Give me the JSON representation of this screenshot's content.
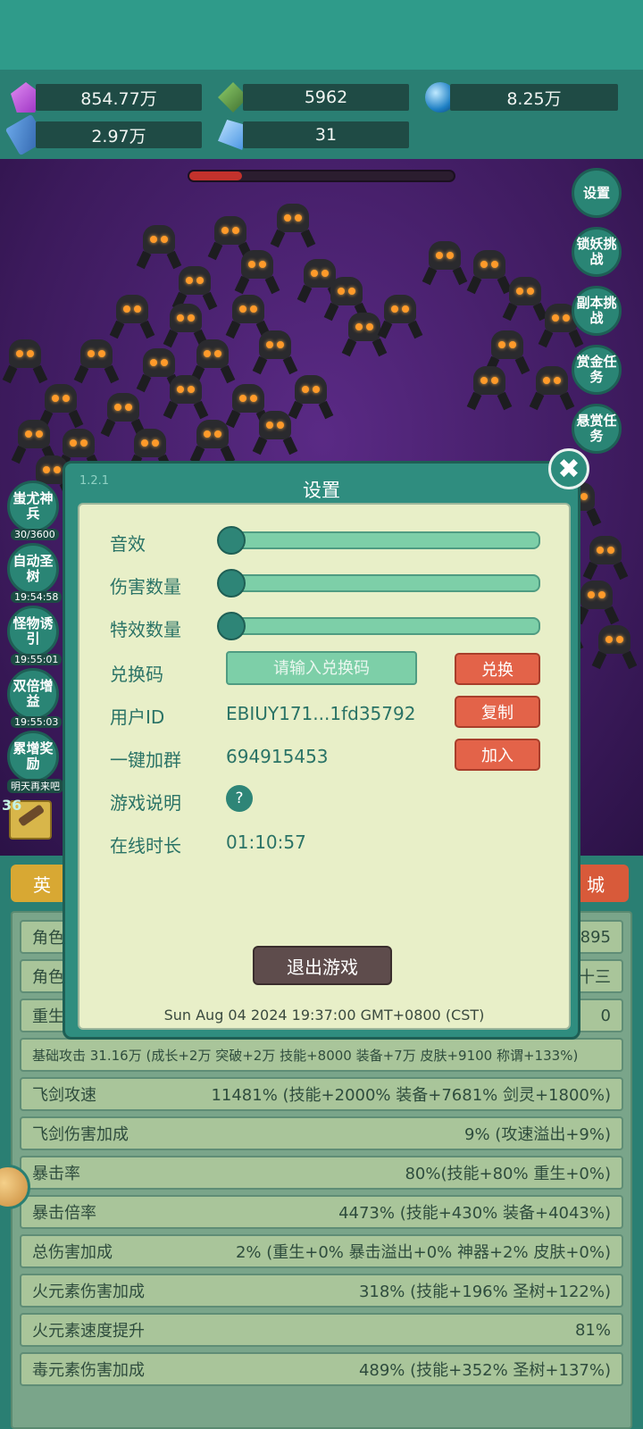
{
  "resources": {
    "gems": "854.77万",
    "jade": "5962",
    "orbs": "8.25万",
    "books": "2.97万",
    "crystals": "31"
  },
  "side_right": [
    "设置",
    "锁妖挑战",
    "副本挑战",
    "赏金任务",
    "悬赏任务"
  ],
  "side_left": [
    {
      "label": "蚩尤神兵",
      "sub": "30/3600"
    },
    {
      "label": "自动圣树",
      "sub": "19:54:58"
    },
    {
      "label": "怪物诱引",
      "sub": "19:55:01"
    },
    {
      "label": "双倍增益",
      "sub": "19:55:03"
    },
    {
      "label": "累增奖励",
      "sub": "明天再来吧"
    }
  ],
  "level_badge": "36",
  "bottom_tabs": {
    "left": "英",
    "right": "城"
  },
  "stats": [
    {
      "label": "角色",
      "value": "895"
    },
    {
      "label": "角色",
      "value": "十三"
    },
    {
      "label": "重生",
      "value": "0"
    },
    {
      "label": "基础攻击 31.16万 (成长+2万 突破+2万 技能+8000 装备+7万 皮肤+9100 称谓+133%)",
      "value": ""
    },
    {
      "label": "飞剑攻速",
      "value": "11481% (技能+2000% 装备+7681% 剑灵+1800%)"
    },
    {
      "label": "飞剑伤害加成",
      "value": "9% (攻速溢出+9%)"
    },
    {
      "label": "暴击率",
      "value": "80%(技能+80% 重生+0%)"
    },
    {
      "label": "暴击倍率",
      "value": "4473% (技能+430% 装备+4043%)"
    },
    {
      "label": "总伤害加成",
      "value": "2% (重生+0% 暴击溢出+0% 神器+2% 皮肤+0%)"
    },
    {
      "label": "火元素伤害加成",
      "value": "318% (技能+196% 圣树+122%)"
    },
    {
      "label": "火元素速度提升",
      "value": "81%"
    },
    {
      "label": "毒元素伤害加成",
      "value": "489% (技能+352% 圣树+137%)"
    }
  ],
  "modal": {
    "version": "1.2.1",
    "title": "设置",
    "sound_label": "音效",
    "sound_level": 0,
    "damage_count_label": "伤害数量",
    "damage_count_level": 0,
    "effects_label": "特效数量",
    "effects_level": 0,
    "redeem_label": "兑换码",
    "redeem_placeholder": "请输入兑换码",
    "redeem_button": "兑换",
    "user_id_label": "用户ID",
    "user_id_value": "EBIUY171...1fd35792",
    "copy_button": "复制",
    "group_label": "一键加群",
    "group_value": "694915453",
    "join_button": "加入",
    "guide_label": "游戏说明",
    "guide_icon": "?",
    "online_label": "在线时长",
    "online_value": "01:10:57",
    "exit_button": "退出游戏",
    "timestamp": "Sun Aug 04 2024 19:37:00 GMT+0800 (CST)",
    "close_icon": "✖"
  }
}
